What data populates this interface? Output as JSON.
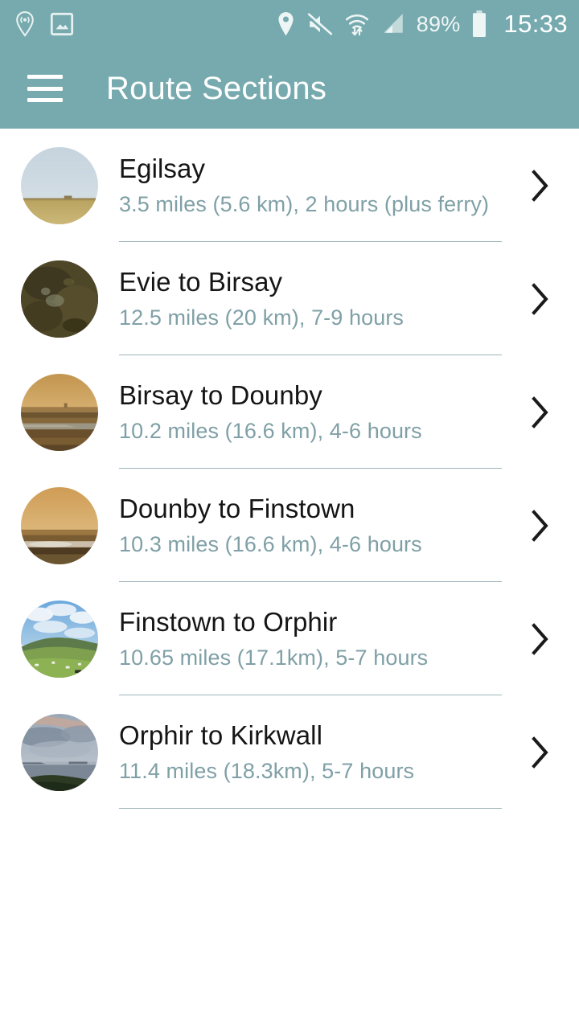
{
  "theme": {
    "app_bar_color": "#76aaae",
    "title_color": "#ffffff",
    "row_title_color": "#151515",
    "row_subtitle_color": "#7fa0a6",
    "divider_color": "#9fb4ba",
    "background_color": "#ffffff"
  },
  "status_bar": {
    "left_icons": [
      {
        "name": "location-sharing-icon",
        "label": "location-sharing"
      },
      {
        "name": "screenshot-image-icon",
        "label": "screenshot"
      }
    ],
    "right_icons": [
      {
        "name": "location-pin-icon",
        "label": "location"
      },
      {
        "name": "volume-mute-icon",
        "label": "muted"
      },
      {
        "name": "wifi-transfer-icon",
        "label": "wifi"
      },
      {
        "name": "cellular-signal-icon",
        "label": "signal"
      }
    ],
    "battery_percent": "89%",
    "battery_icon": "battery-icon",
    "clock": "15:33"
  },
  "app_bar": {
    "menu_icon": "hamburger-menu-icon",
    "title": "Route Sections"
  },
  "list": {
    "chevron_icon": "chevron-right-icon",
    "items": [
      {
        "title": "Egilsay",
        "subtitle": "3.5 miles (5.6 km), 2 hours (plus ferry)",
        "thumbnail": "pale-sky-over-barley-field"
      },
      {
        "title": "Evie to Birsay",
        "subtitle": "12.5 miles (20 km), 7-9 hours",
        "thumbnail": "dark-mossy-rock"
      },
      {
        "title": "Birsay to Dounby",
        "subtitle": "10.2 miles (16.6 km), 4-6 hours",
        "thumbnail": "golden-sunset-over-moorland"
      },
      {
        "title": "Dounby to Finstown",
        "subtitle": "10.3 miles (16.6 km), 4-6 hours",
        "thumbnail": "amber-sunset-over-loch"
      },
      {
        "title": "Finstown to Orphir",
        "subtitle": "10.65 miles (17.1km), 5-7 hours",
        "thumbnail": "green-hill-and-farmland-under-blue-sky"
      },
      {
        "title": "Orphir to Kirkwall",
        "subtitle": "11.4 miles (18.3km), 5-7 hours",
        "thumbnail": "dusk-clouds-over-grey-sea"
      }
    ]
  }
}
